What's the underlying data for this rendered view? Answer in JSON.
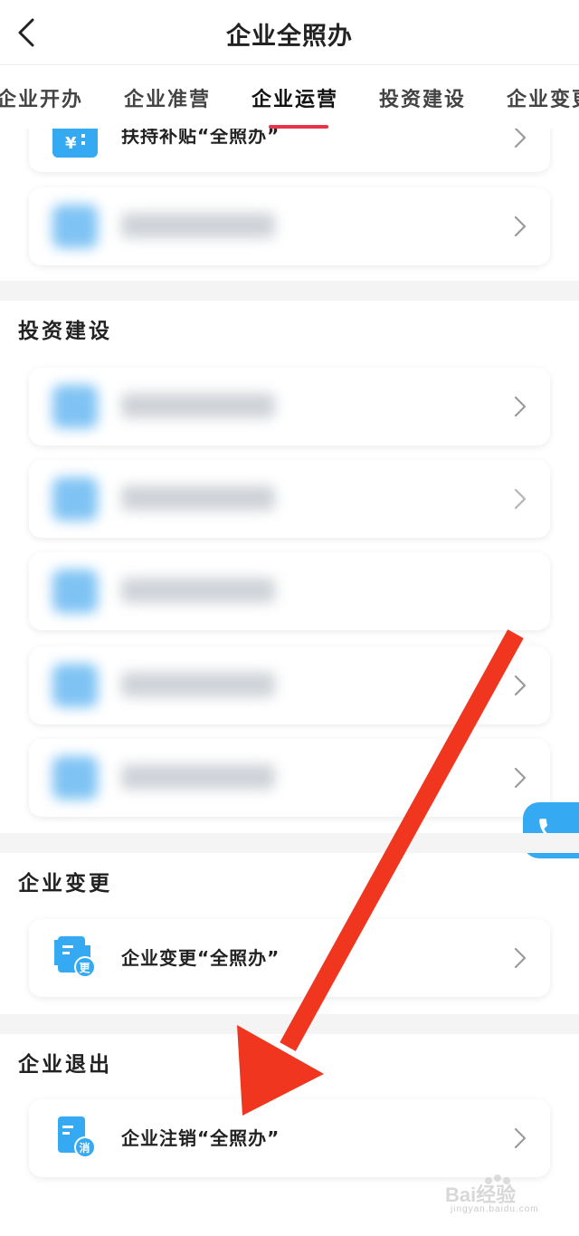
{
  "header": {
    "title": "企业全照办"
  },
  "tabs": [
    {
      "label": "企业开办"
    },
    {
      "label": "企业准营"
    },
    {
      "label": "企业运营"
    },
    {
      "label": "投资建设"
    },
    {
      "label": "企业变更"
    }
  ],
  "partial_card": {
    "label": "扶持补贴“全照办”"
  },
  "sections": {
    "investment": {
      "title": "投资建设"
    },
    "change": {
      "title": "企业变更",
      "card_label": "企业变更“全照办”",
      "badge": "更"
    },
    "exit": {
      "title": "企业退出",
      "card_label": "企业注销“全照办”",
      "badge": "消"
    }
  },
  "watermark": {
    "brand": "Bai经验",
    "url": "jingyan.baidu.com"
  },
  "colors": {
    "accent": "#e8344a",
    "icon_blue": "#35a9f1",
    "arrow_red": "#f0361f"
  }
}
